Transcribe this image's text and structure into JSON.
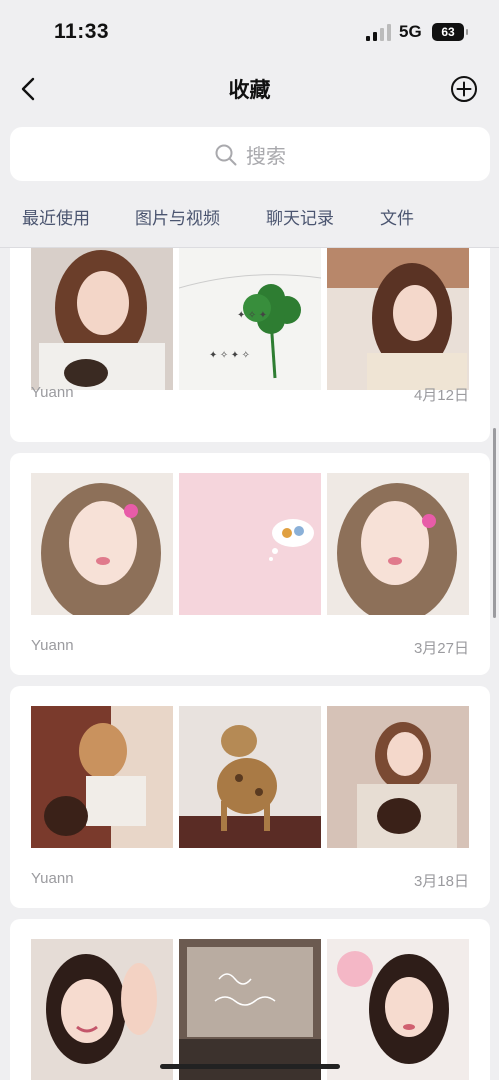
{
  "status_bar": {
    "time": "11:33",
    "network": "5G",
    "battery": "63"
  },
  "nav": {
    "title": "收藏"
  },
  "search": {
    "placeholder": "搜索"
  },
  "tabs": [
    {
      "label": "最近使用"
    },
    {
      "label": "图片与视频"
    },
    {
      "label": "聊天记录"
    },
    {
      "label": "文件"
    }
  ],
  "cards": [
    {
      "user": "Yuann",
      "date": "4月12日",
      "images": [
        "portrait with dog",
        "four-leaf clover on book",
        "portrait with headband"
      ]
    },
    {
      "user": "Yuann",
      "date": "3月27日",
      "images": [
        "portrait with pink hair clip",
        "pink background with food sticker",
        "portrait with pink hair clip"
      ]
    },
    {
      "user": "Yuann",
      "date": "3月18日",
      "images": [
        "portrait with dachshund",
        "bengal cat",
        "portrait with dachshund"
      ]
    },
    {
      "user": "",
      "date": "",
      "images": [
        "smiling portrait waving",
        "window with handwritten text",
        "portrait with flowers"
      ]
    }
  ],
  "colors": {
    "accent_text": "#4b5570",
    "meta_text": "#9b9b9f",
    "background": "#efeff1"
  }
}
